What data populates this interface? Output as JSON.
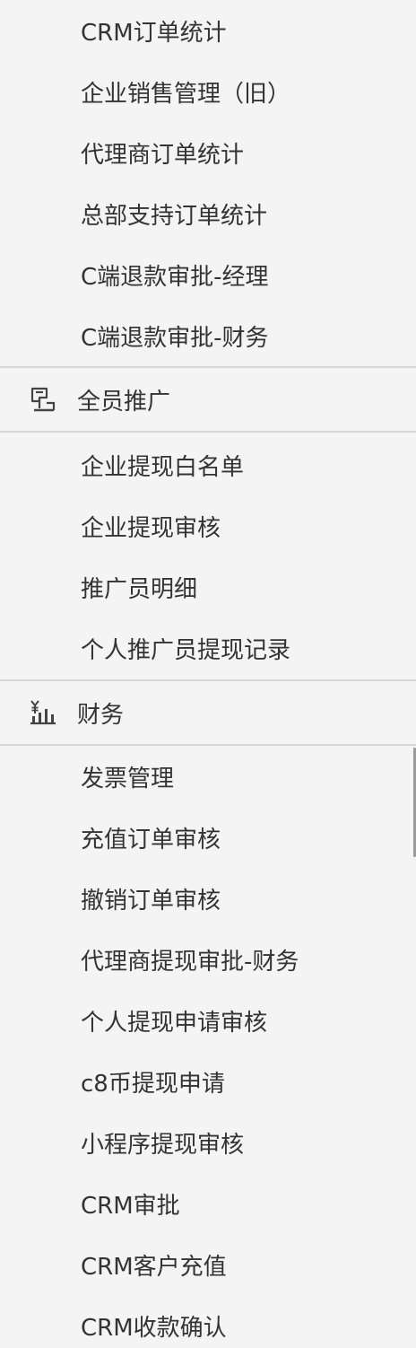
{
  "section_crm": {
    "items": [
      {
        "label": "CRM订单统计"
      },
      {
        "label": "企业销售管理（旧）"
      },
      {
        "label": "代理商订单统计"
      },
      {
        "label": "总部支持订单统计"
      },
      {
        "label": "C端退款审批-经理"
      },
      {
        "label": "C端退款审批-财务"
      }
    ]
  },
  "group_promotion": {
    "label": "全员推广",
    "icon": "flag-podium-icon",
    "items": [
      {
        "label": "企业提现白名单"
      },
      {
        "label": "企业提现审核"
      },
      {
        "label": "推广员明细"
      },
      {
        "label": "个人推广员提现记录"
      }
    ]
  },
  "group_finance": {
    "label": "财务",
    "icon": "yen-chart-icon",
    "items": [
      {
        "label": "发票管理"
      },
      {
        "label": "充值订单审核"
      },
      {
        "label": "撤销订单审核"
      },
      {
        "label": "代理商提现审批-财务"
      },
      {
        "label": "个人提现申请审核"
      },
      {
        "label": "c8币提现申请"
      },
      {
        "label": "小程序提现审核"
      },
      {
        "label": "CRM审批"
      },
      {
        "label": "CRM客户充值"
      },
      {
        "label": "CRM收款确认"
      }
    ]
  }
}
